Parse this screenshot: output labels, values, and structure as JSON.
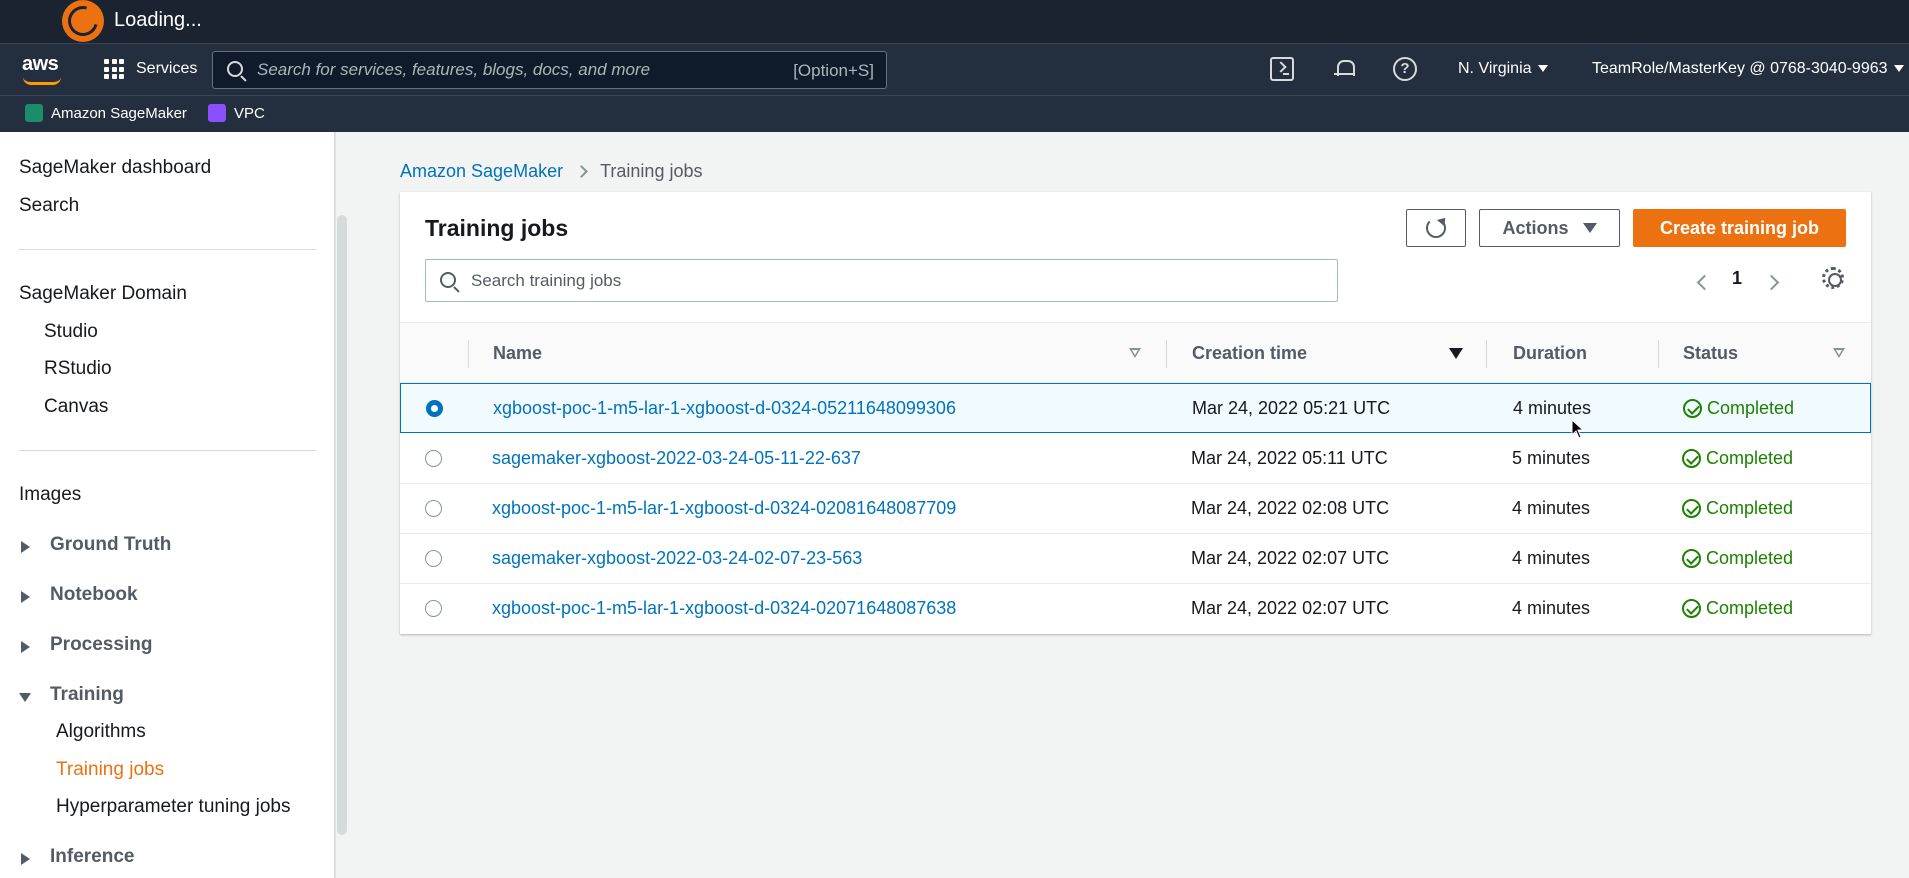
{
  "loading": {
    "text": "Loading..."
  },
  "topnav": {
    "logo": "aws",
    "services_label": "Services",
    "search_placeholder": "Search for services, features, blogs, docs, and more",
    "search_shortcut": "[Option+S]",
    "region": "N. Virginia",
    "account": "TeamRole/MasterKey @ 0768-3040-9963"
  },
  "favorites": [
    {
      "label": "Amazon SageMaker",
      "icon": "sagemaker-icon"
    },
    {
      "label": "VPC",
      "icon": "vpc-icon"
    }
  ],
  "sidebar": {
    "top_items": [
      "SageMaker dashboard",
      "Search"
    ],
    "domain_header": "SageMaker Domain",
    "domain_items": [
      "Studio",
      "RStudio",
      "Canvas"
    ],
    "images": "Images",
    "groups": [
      "Ground Truth",
      "Notebook",
      "Processing"
    ],
    "training_group": "Training",
    "training_items": [
      "Algorithms",
      "Training jobs",
      "Hyperparameter tuning jobs"
    ],
    "inference_group": "Inference"
  },
  "breadcrumb": {
    "root": "Amazon SageMaker",
    "current": "Training jobs"
  },
  "panel": {
    "title": "Training jobs",
    "actions_label": "Actions",
    "create_label": "Create training job",
    "search_placeholder": "Search training jobs",
    "page": "1"
  },
  "table": {
    "columns": [
      "Name",
      "Creation time",
      "Duration",
      "Status"
    ],
    "rows": [
      {
        "name": "xgboost-poc-1-m5-lar-1-xgboost-d-0324-05211648099306",
        "created": "Mar 24, 2022 05:21 UTC",
        "duration": "4 minutes",
        "status": "Completed",
        "selected": true
      },
      {
        "name": "sagemaker-xgboost-2022-03-24-05-11-22-637",
        "created": "Mar 24, 2022 05:11 UTC",
        "duration": "5 minutes",
        "status": "Completed",
        "selected": false
      },
      {
        "name": "xgboost-poc-1-m5-lar-1-xgboost-d-0324-02081648087709",
        "created": "Mar 24, 2022 02:08 UTC",
        "duration": "4 minutes",
        "status": "Completed",
        "selected": false
      },
      {
        "name": "sagemaker-xgboost-2022-03-24-02-07-23-563",
        "created": "Mar 24, 2022 02:07 UTC",
        "duration": "4 minutes",
        "status": "Completed",
        "selected": false
      },
      {
        "name": "xgboost-poc-1-m5-lar-1-xgboost-d-0324-02071648087638",
        "created": "Mar 24, 2022 02:07 UTC",
        "duration": "4 minutes",
        "status": "Completed",
        "selected": false
      }
    ]
  },
  "colors": {
    "accent": "#ec7211",
    "link": "#0073bb",
    "success": "#1d8102",
    "nav_bg": "#232f3e"
  }
}
